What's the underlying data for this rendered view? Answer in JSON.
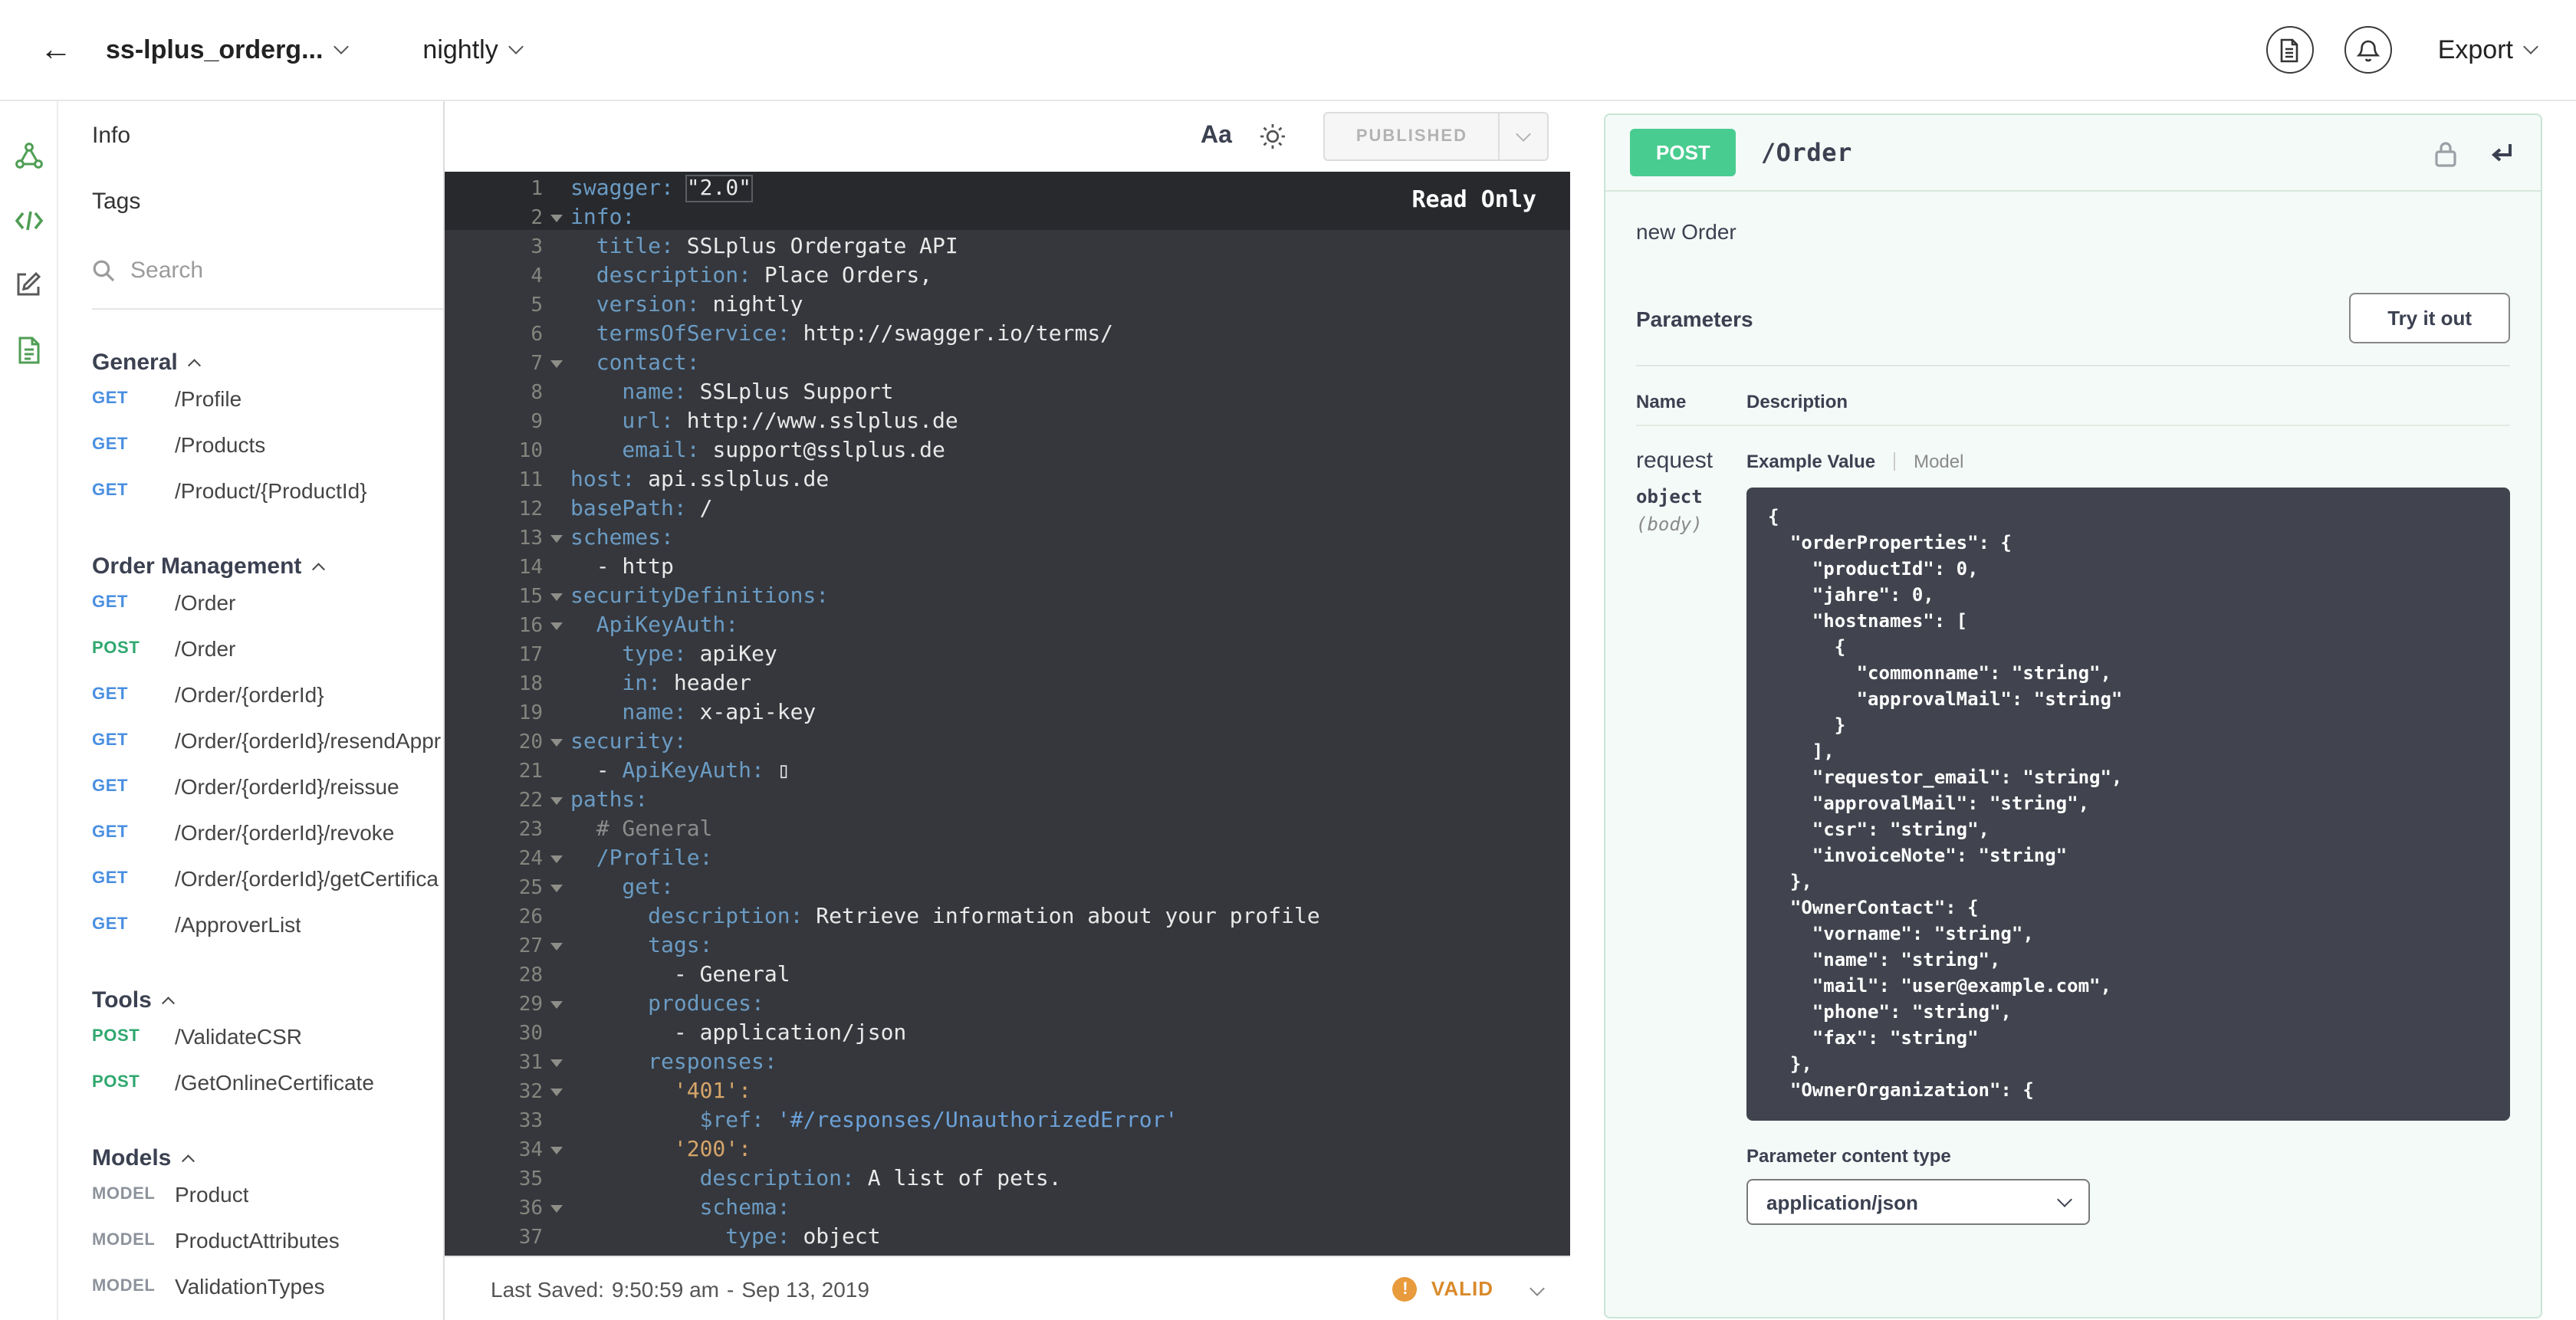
{
  "colors": {
    "post_green": "#49cc90",
    "get_blue": "#4a8fe0",
    "valid_orange": "#d98a2b",
    "editor_bg": "#35373c"
  },
  "topbar": {
    "api_name": "ss-lplus_orderg...",
    "version": "nightly",
    "export_label": "Export"
  },
  "sidebar": {
    "info_label": "Info",
    "tags_label": "Tags",
    "search_placeholder": "Search",
    "sections": [
      {
        "title": "General",
        "items": [
          {
            "method": "GET",
            "path": "/Profile"
          },
          {
            "method": "GET",
            "path": "/Products"
          },
          {
            "method": "GET",
            "path": "/Product/{ProductId}"
          }
        ]
      },
      {
        "title": "Order Management",
        "items": [
          {
            "method": "GET",
            "path": "/Order"
          },
          {
            "method": "POST",
            "path": "/Order"
          },
          {
            "method": "GET",
            "path": "/Order/{orderId}"
          },
          {
            "method": "GET",
            "path": "/Order/{orderId}/resendAppr"
          },
          {
            "method": "GET",
            "path": "/Order/{orderId}/reissue"
          },
          {
            "method": "GET",
            "path": "/Order/{orderId}/revoke"
          },
          {
            "method": "GET",
            "path": "/Order/{orderId}/getCertifica"
          },
          {
            "method": "GET",
            "path": "/ApproverList"
          }
        ]
      },
      {
        "title": "Tools",
        "items": [
          {
            "method": "POST",
            "path": "/ValidateCSR"
          },
          {
            "method": "POST",
            "path": "/GetOnlineCertificate"
          }
        ]
      },
      {
        "title": "Models",
        "items": [
          {
            "method": "MODEL",
            "path": "Product"
          },
          {
            "method": "MODEL",
            "path": "ProductAttributes"
          },
          {
            "method": "MODEL",
            "path": "ValidationTypes"
          }
        ]
      }
    ]
  },
  "editor": {
    "font_button": "Aa",
    "published_label": "PUBLISHED",
    "read_only_label": "Read Only",
    "status": {
      "last_saved_label": "Last Saved:",
      "time": "9:50:59 am",
      "separator": "-",
      "date": "Sep 13, 2019",
      "validity": "VALID"
    },
    "lines": [
      {
        "f": false,
        "t": [
          [
            "k",
            "swagger:"
          ],
          [
            "p",
            " "
          ],
          [
            "s",
            "\"2.0\""
          ]
        ]
      },
      {
        "f": true,
        "t": [
          [
            "k",
            "info:"
          ]
        ]
      },
      {
        "f": false,
        "t": [
          [
            "k",
            "  title:"
          ],
          [
            "p",
            " SSLplus Ordergate API"
          ]
        ]
      },
      {
        "f": false,
        "t": [
          [
            "k",
            "  description:"
          ],
          [
            "p",
            " Place Orders,"
          ]
        ]
      },
      {
        "f": false,
        "t": [
          [
            "k",
            "  version:"
          ],
          [
            "p",
            " nightly"
          ]
        ]
      },
      {
        "f": false,
        "t": [
          [
            "k",
            "  termsOfService:"
          ],
          [
            "p",
            " http://swagger.io/terms/"
          ]
        ]
      },
      {
        "f": true,
        "t": [
          [
            "k",
            "  contact:"
          ]
        ]
      },
      {
        "f": false,
        "t": [
          [
            "k",
            "    name:"
          ],
          [
            "p",
            " SSLplus Support"
          ]
        ]
      },
      {
        "f": false,
        "t": [
          [
            "k",
            "    url:"
          ],
          [
            "p",
            " http://www.sslplus.de"
          ]
        ]
      },
      {
        "f": false,
        "t": [
          [
            "k",
            "    email:"
          ],
          [
            "p",
            " support@sslplus.de"
          ]
        ]
      },
      {
        "f": false,
        "t": [
          [
            "k",
            "host:"
          ],
          [
            "p",
            " api.sslplus.de"
          ]
        ]
      },
      {
        "f": false,
        "t": [
          [
            "k",
            "basePath:"
          ],
          [
            "p",
            " /"
          ]
        ]
      },
      {
        "f": true,
        "t": [
          [
            "k",
            "schemes:"
          ]
        ]
      },
      {
        "f": false,
        "t": [
          [
            "p",
            "  - http"
          ]
        ]
      },
      {
        "f": true,
        "t": [
          [
            "k",
            "securityDefinitions:"
          ]
        ]
      },
      {
        "f": true,
        "t": [
          [
            "k",
            "  ApiKeyAuth:"
          ]
        ]
      },
      {
        "f": false,
        "t": [
          [
            "k",
            "    type:"
          ],
          [
            "p",
            " apiKey"
          ]
        ]
      },
      {
        "f": false,
        "t": [
          [
            "k",
            "    in:"
          ],
          [
            "p",
            " header"
          ]
        ]
      },
      {
        "f": false,
        "t": [
          [
            "k",
            "    name:"
          ],
          [
            "p",
            " x-api-key"
          ]
        ]
      },
      {
        "f": true,
        "t": [
          [
            "k",
            "security:"
          ]
        ]
      },
      {
        "f": false,
        "t": [
          [
            "p",
            "  - "
          ],
          [
            "k",
            "ApiKeyAuth:"
          ],
          [
            "p",
            " ▯"
          ]
        ]
      },
      {
        "f": true,
        "t": [
          [
            "k",
            "paths:"
          ]
        ]
      },
      {
        "f": false,
        "t": [
          [
            "c",
            "  # General"
          ]
        ]
      },
      {
        "f": true,
        "t": [
          [
            "k",
            "  /Profile:"
          ]
        ]
      },
      {
        "f": true,
        "t": [
          [
            "k",
            "    get:"
          ]
        ]
      },
      {
        "f": false,
        "t": [
          [
            "k",
            "      description:"
          ],
          [
            "p",
            " Retrieve information about your profile"
          ]
        ]
      },
      {
        "f": true,
        "t": [
          [
            "k",
            "      tags:"
          ]
        ]
      },
      {
        "f": false,
        "t": [
          [
            "p",
            "        - General"
          ]
        ]
      },
      {
        "f": true,
        "t": [
          [
            "k",
            "      produces:"
          ]
        ]
      },
      {
        "f": false,
        "t": [
          [
            "p",
            "        - application/json"
          ]
        ]
      },
      {
        "f": true,
        "t": [
          [
            "k",
            "      responses:"
          ]
        ]
      },
      {
        "f": true,
        "t": [
          [
            "n",
            "        '401':"
          ]
        ]
      },
      {
        "f": false,
        "t": [
          [
            "k",
            "          $ref:"
          ],
          [
            "p",
            " "
          ],
          [
            "l",
            "'#/responses/UnauthorizedError'"
          ]
        ]
      },
      {
        "f": true,
        "t": [
          [
            "n",
            "        '200':"
          ]
        ]
      },
      {
        "f": false,
        "t": [
          [
            "k",
            "          description:"
          ],
          [
            "p",
            " A list of pets."
          ]
        ]
      },
      {
        "f": true,
        "t": [
          [
            "k",
            "          schema:"
          ]
        ]
      },
      {
        "f": false,
        "t": [
          [
            "k",
            "            type:"
          ],
          [
            "p",
            " object"
          ]
        ]
      }
    ]
  },
  "preview": {
    "method": "POST",
    "path": "/Order",
    "summary": "new Order",
    "parameters_label": "Parameters",
    "try_it_out_label": "Try it out",
    "table": {
      "name_header": "Name",
      "description_header": "Description"
    },
    "param": {
      "name": "request",
      "type": "object",
      "in": "(body)"
    },
    "tabs": {
      "example": "Example Value",
      "model": "Model"
    },
    "body_example": [
      "{",
      "  \"orderProperties\": {",
      "    \"productId\": 0,",
      "    \"jahre\": 0,",
      "    \"hostnames\": [",
      "      {",
      "        \"commonname\": \"string\",",
      "        \"approvalMail\": \"string\"",
      "      }",
      "    ],",
      "    \"requestor_email\": \"string\",",
      "    \"approvalMail\": \"string\",",
      "    \"csr\": \"string\",",
      "    \"invoiceNote\": \"string\"",
      "  },",
      "  \"OwnerContact\": {",
      "    \"vorname\": \"string\",",
      "    \"name\": \"string\",",
      "    \"mail\": \"user@example.com\",",
      "    \"phone\": \"string\",",
      "    \"fax\": \"string\"",
      "  },",
      "  \"OwnerOrganization\": {"
    ],
    "content_type_label": "Parameter content type",
    "content_type_value": "application/json"
  }
}
